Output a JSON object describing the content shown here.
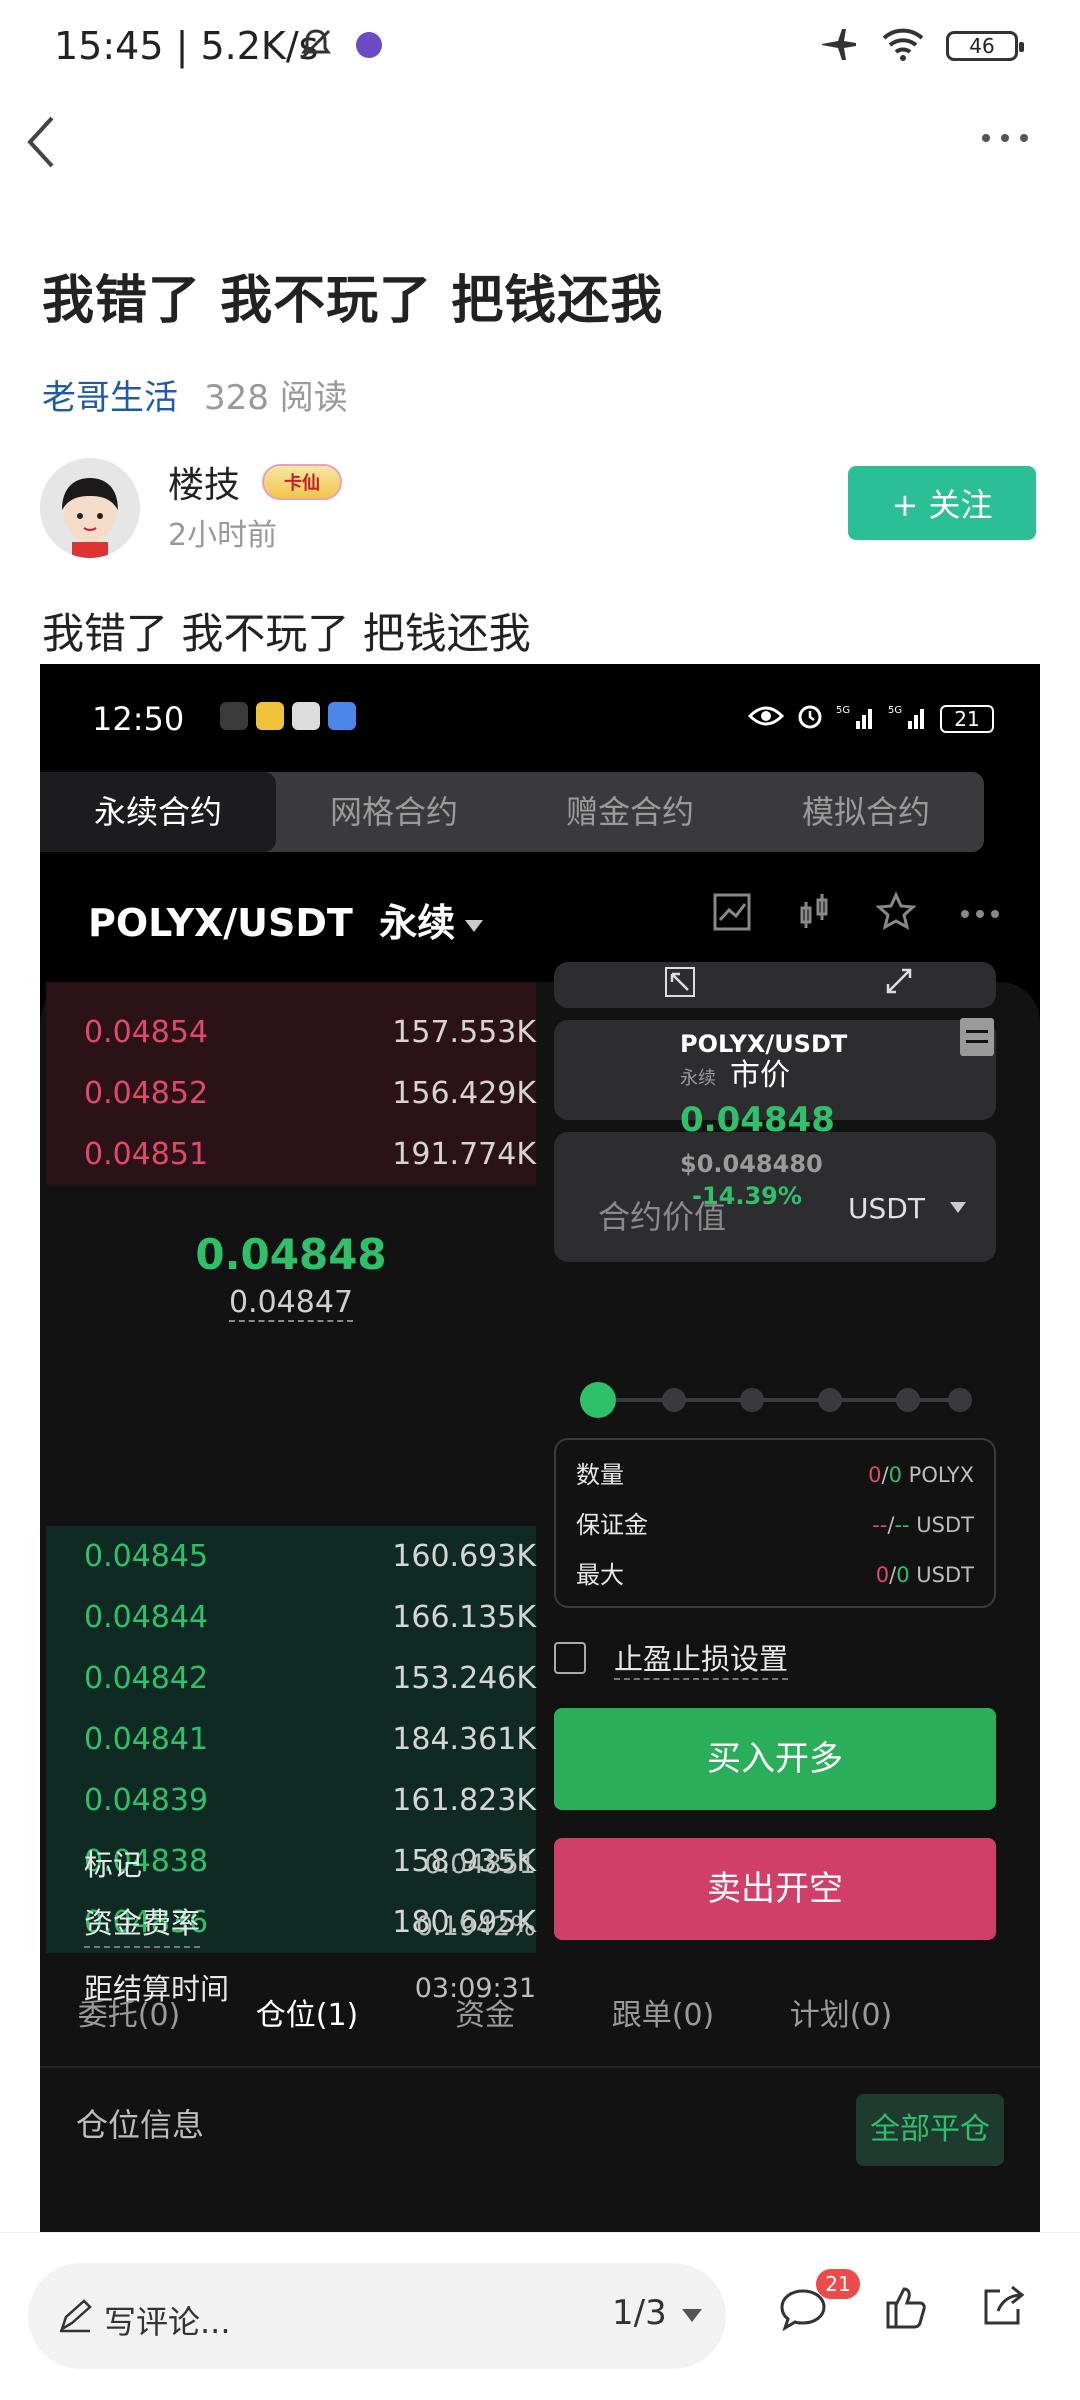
{
  "status_bar": {
    "time": "15:45 | 5.2K/s",
    "battery": "46"
  },
  "article": {
    "title": "我错了 我不玩了 把钱还我",
    "channel": "老哥生活",
    "reads": "328 阅读",
    "author": {
      "name": "楼技",
      "badge": "卡仙",
      "time": "2小时前"
    },
    "follow_label": "+ 关注",
    "body": "我错了 我不玩了 把钱还我"
  },
  "screenshot": {
    "status": {
      "time": "12:50",
      "battery": "21"
    },
    "tabs": [
      "永续合约",
      "网格合约",
      "赠金合约",
      "模拟合约"
    ],
    "pair": "POLYX/USDT  永续",
    "asks": [
      {
        "price": "0.04854",
        "qty": "157.553K"
      },
      {
        "price": "0.04852",
        "qty": "156.429K"
      },
      {
        "price": "0.04851",
        "qty": "191.774K"
      }
    ],
    "mid": {
      "price": "0.04848",
      "mark": "0.04847"
    },
    "bids": [
      {
        "price": "0.04845",
        "qty": "160.693K"
      },
      {
        "price": "0.04844",
        "qty": "166.135K"
      },
      {
        "price": "0.04842",
        "qty": "153.246K"
      },
      {
        "price": "0.04841",
        "qty": "184.361K"
      },
      {
        "price": "0.04839",
        "qty": "161.823K"
      },
      {
        "price": "0.04838",
        "qty": "158.935K"
      },
      {
        "price": "0.04836",
        "qty": "180.695K"
      }
    ],
    "stats": [
      {
        "label": "标记",
        "value": "0.04851"
      },
      {
        "label": "资金费率",
        "value": "0.1942%"
      },
      {
        "label": "距结算时间",
        "value": "03:09:31"
      }
    ],
    "mini_ticker": {
      "pair": "POLYX/USDT",
      "sub": "永续",
      "market": "市价",
      "price": "0.04848",
      "usd": "$0.048480",
      "change": "-14.39%"
    },
    "value_input": {
      "placeholder": "合约价值",
      "unit": "USDT"
    },
    "slider_level": 0,
    "info": [
      {
        "label": "数量",
        "a": "0",
        "b": "0",
        "unit": "POLYX"
      },
      {
        "label": "保证金",
        "a": "--",
        "b": "--",
        "unit": "USDT"
      },
      {
        "label": "最大",
        "a": "0",
        "b": "0",
        "unit": "USDT"
      }
    ],
    "tpsl_label": "止盈止损设置",
    "buy_label": "买入开多",
    "sell_label": "卖出开空",
    "pos_tabs": [
      "委托(0)",
      "仓位(1)",
      "资金",
      "跟单(0)",
      "计划(0)"
    ],
    "pos_info_label": "仓位信息",
    "close_all_label": "全部平仓"
  },
  "bottom_bar": {
    "comment_placeholder": "写评论...",
    "pager": "1/3",
    "comment_count": "21"
  },
  "colors": {
    "accent": "#2bbf95",
    "buy": "#2aae5a",
    "sell": "#cf3f68",
    "link": "#1e5aa8"
  }
}
